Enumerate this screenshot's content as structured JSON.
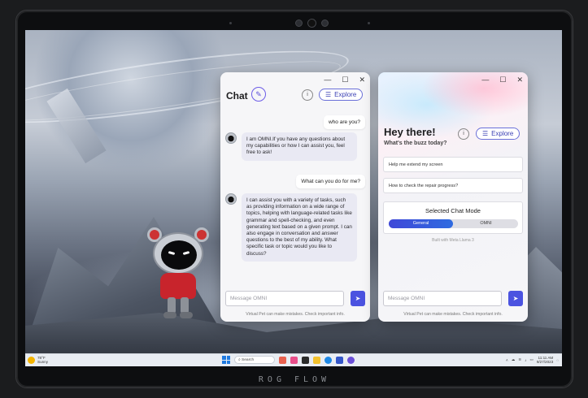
{
  "device": {
    "brand": "ROG FLOW"
  },
  "chat_window": {
    "title": "Chat",
    "explore_label": "Explore",
    "info_label": "i",
    "controls": {
      "minimize": "—",
      "maximize": "☐",
      "close": "✕"
    },
    "messages": [
      {
        "role": "user",
        "text": "who are you?"
      },
      {
        "role": "assistant",
        "text": "I am OMNI.If you have any questions about my capabilities or how I can assist you, feel free to ask!"
      },
      {
        "role": "user",
        "text": "What can you do for me?"
      },
      {
        "role": "assistant",
        "text": "I can assist you with a variety of tasks, such as providing information on a wide range of topics, helping with language-related tasks like grammar and spell-checking, and even generating text based on a given prompt. I can also engage in conversation and answer questions to the best of my ability. What specific task or topic would you like to discuss?"
      }
    ],
    "input_placeholder": "Message OMNI",
    "disclaimer": "Virtual Pet can make mistakes. Check important info."
  },
  "home_window": {
    "greeting": "Hey there!",
    "subtitle": "What's the buzz today?",
    "explore_label": "Explore",
    "info_label": "i",
    "controls": {
      "minimize": "—",
      "maximize": "☐",
      "close": "✕"
    },
    "suggestions": [
      "Help me extend my screen",
      "How to check the repair progress?"
    ],
    "mode_title": "Selected Chat Mode",
    "modes": {
      "active": "General",
      "inactive": "OMNI"
    },
    "built_with": "Built with Meta Llama 3",
    "input_placeholder": "Message OMNI",
    "disclaimer": "Virtual Pet can make mistakes. Check important info."
  },
  "taskbar": {
    "weather_temp": "78°F",
    "weather_cond": "Sunny",
    "search_label": "Search",
    "time": "11:11 AM",
    "date": "9/27/2023"
  },
  "colors": {
    "accent": "#4b53e0",
    "explore_border": "#6a6fd8"
  }
}
